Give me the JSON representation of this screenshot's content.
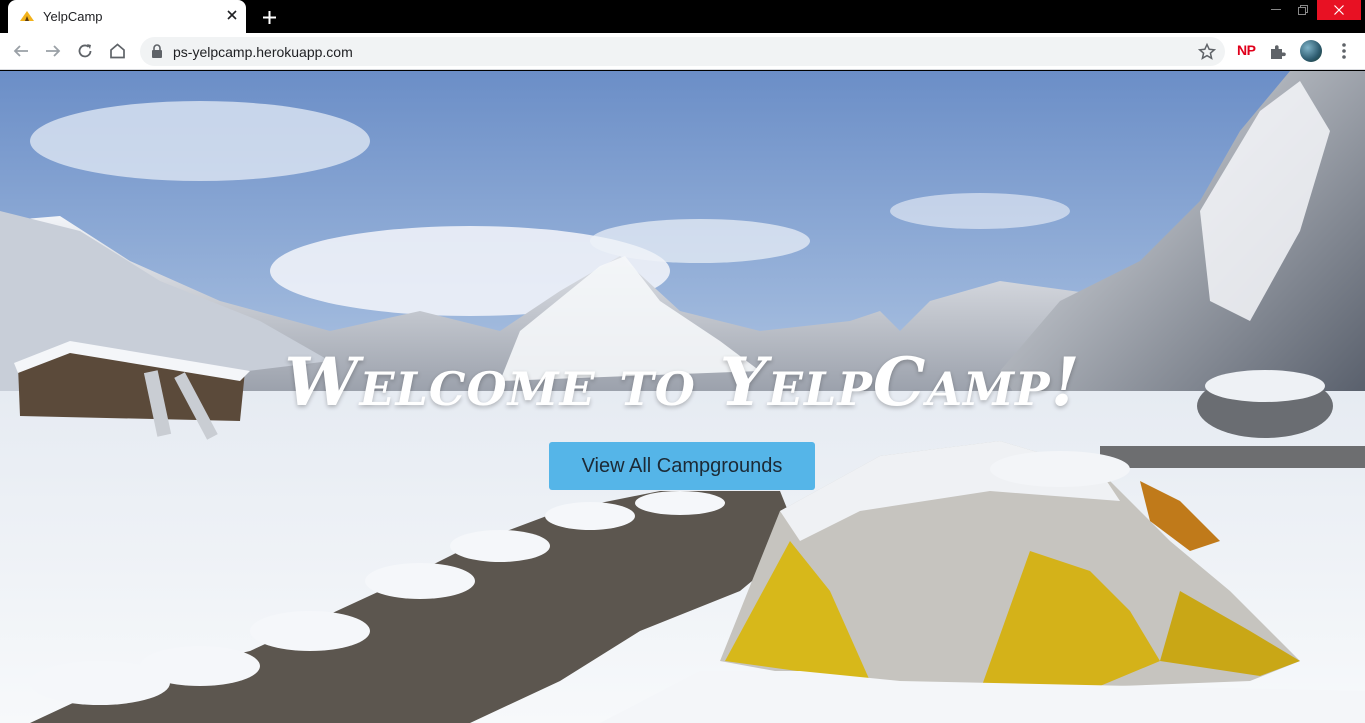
{
  "browser": {
    "tab": {
      "title": "YelpCamp",
      "favicon": "tent-icon"
    },
    "url": "ps-yelpcamp.herokuapp.com",
    "extensions": {
      "np_label": "NP"
    }
  },
  "hero": {
    "title": "Welcome to YelpCamp!",
    "button_label": "View All Campgrounds"
  },
  "colors": {
    "button_bg": "#55b5e8",
    "window_close": "#e81123"
  }
}
